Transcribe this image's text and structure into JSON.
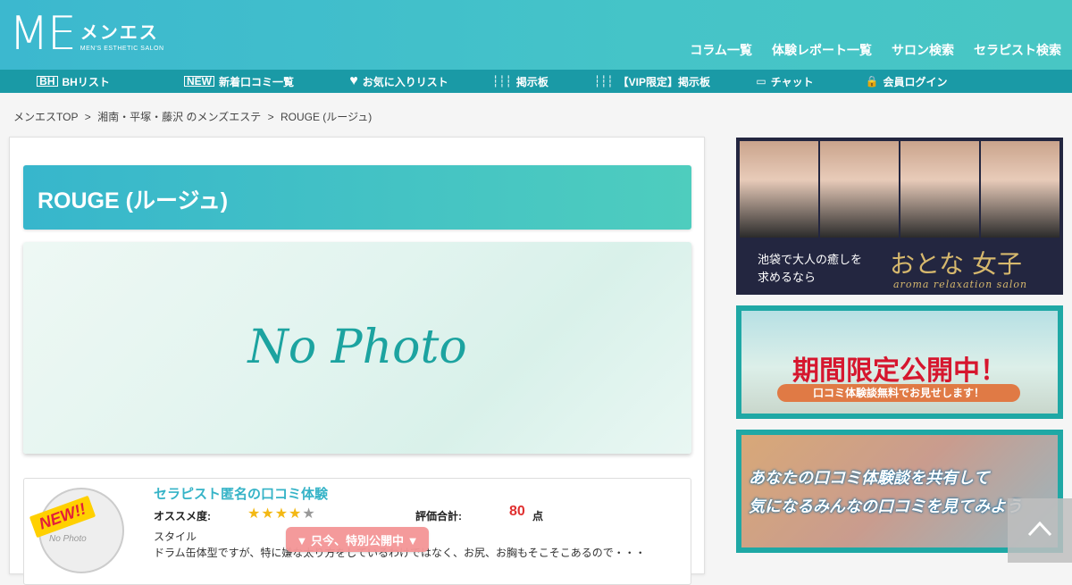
{
  "header": {
    "logo_me": "ME",
    "logo_kana": "メンエス",
    "logo_sub": "MEN'S ESTHETIC SALON",
    "nav": [
      "コラム一覧",
      "体験レポート一覧",
      "サロン検索",
      "セラピスト検索"
    ]
  },
  "subnav": [
    {
      "label": "BHリスト",
      "icon": "bh-icon",
      "icon_text": "BH"
    },
    {
      "label": "新着口コミ一覧",
      "icon": "new-icon",
      "icon_text": "NEW"
    },
    {
      "label": "お気に入りリスト",
      "icon": "heart-icon",
      "icon_text": "♥"
    },
    {
      "label": "掲示板",
      "icon": "board-icon",
      "icon_text": "┆┆┆"
    },
    {
      "label": "【VIP限定】掲示板",
      "icon": "board-icon",
      "icon_text": "┆┆┆"
    },
    {
      "label": "チャット",
      "icon": "chat-icon",
      "icon_text": "▭"
    },
    {
      "label": "会員ログイン",
      "icon": "lock-icon",
      "icon_text": "🔒"
    }
  ],
  "breadcrumb": [
    "メンエスTOP",
    ">",
    "湘南・平塚・藤沢 のメンズエステ",
    ">",
    "ROUGE (ルージュ)"
  ],
  "main": {
    "title": "ROUGE (ルージュ)",
    "photo_placeholder": "No Photo"
  },
  "review": {
    "badge": "NEW!!",
    "avatar_text": "No Photo",
    "title": "セラピスト匿名の口コミ体験",
    "recommend_label": "オススメ度:",
    "stars_filled": 4,
    "stars_total": 5,
    "total_label": "評価合計:",
    "total_value": "80",
    "total_unit": "点",
    "style_label": "スタイル",
    "comment": "ドラム缶体型ですが、特に嫌な太り方をしているわけではなく、お尻、お胸もそこそこあるので・・・"
  },
  "popup": "▼ 只今、特別公開中 ▼",
  "sidebar": {
    "banner1": {
      "caption_line1": "池袋で大人の癒しを",
      "caption_line2": "求めるなら",
      "brand": "おとな 女子",
      "brand_sub": "aroma relaxation salon"
    },
    "banner2": {
      "headline": "期間限定公開中！",
      "pill": "口コミ体験談無料でお見せします！"
    },
    "banner3": {
      "line1": "あなたの口コミ体験談を共有して",
      "line2": "気になるみんなの口コミを見てみよう"
    }
  },
  "colors": {
    "header": "#40bfca",
    "subnav": "#1a9aa6",
    "accent_red": "#e03030",
    "star": "#f3b814"
  }
}
